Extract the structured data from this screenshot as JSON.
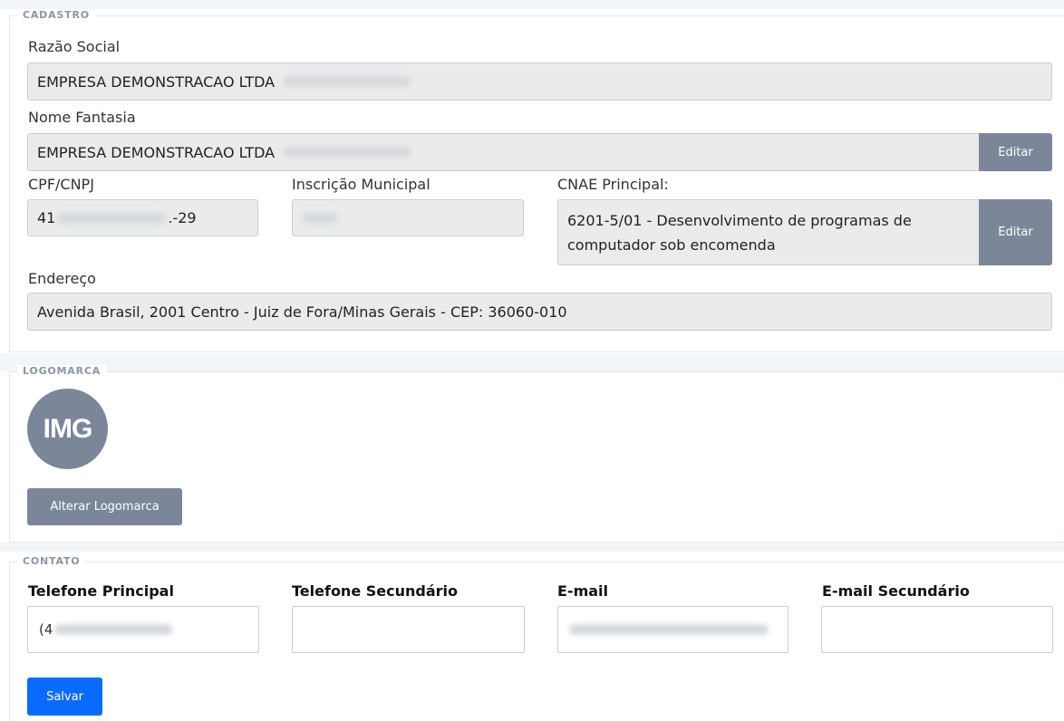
{
  "cadastro": {
    "legend": "CADASTRO",
    "razao_social_label": "Razão Social",
    "razao_social_value": "EMPRESA DEMONSTRACAO LTDA",
    "nome_fantasia_label": "Nome Fantasia",
    "nome_fantasia_value": "EMPRESA DEMONSTRACAO LTDA",
    "edit_label": "Editar",
    "cpf_label": "CPF/CNPJ",
    "cpf_prefix": "41",
    "cpf_suffix": ".-29",
    "inscricao_label": "Inscrição Municipal",
    "cnae_label": "CNAE Principal:",
    "cnae_value": "6201-5/01 - Desenvolvimento de programas de computador sob encomenda",
    "cnae_edit_label": "Editar",
    "endereco_label": "Endereço",
    "endereco_value": "Avenida Brasil, 2001 Centro - Juiz de Fora/Minas Gerais - CEP: 36060-010"
  },
  "logomarca": {
    "legend": "LOGOMARCA",
    "avatar_text": "IMG",
    "change_button": "Alterar Logomarca"
  },
  "contato": {
    "legend": "CONTATO",
    "telefone_principal_label": "Telefone Principal",
    "telefone_principal_prefix": "(4",
    "telefone_secundario_label": "Telefone Secundário",
    "email_label": "E-mail",
    "email_secundario_label": "E-mail Secundário",
    "save_button": "Salvar"
  },
  "colors": {
    "accent": "#0a6cff",
    "secondary_button": "#7b8799",
    "readonly_field": "#ebebeb"
  }
}
